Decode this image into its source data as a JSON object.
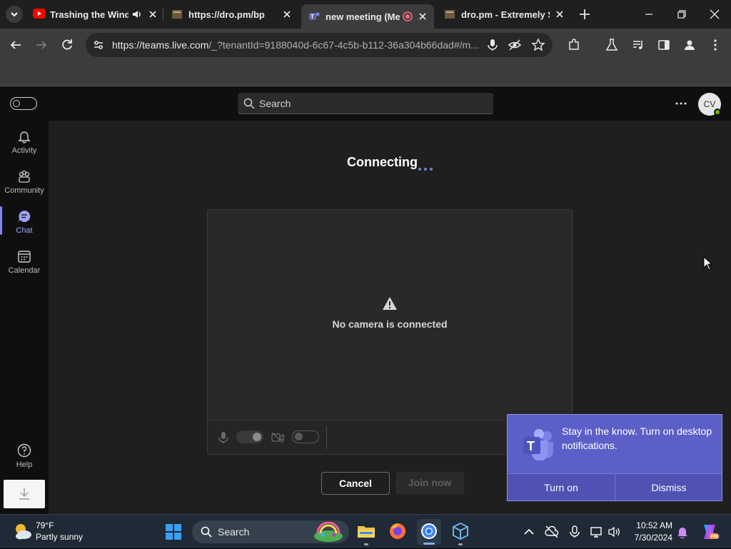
{
  "browser": {
    "tabs": [
      {
        "title": "Trashing the Windo",
        "favicon": "youtube-icon",
        "audio": "speaker-icon"
      },
      {
        "title": "https://dro.pm/bp",
        "favicon": "page-icon"
      },
      {
        "title": "new meeting (Mee",
        "favicon": "teams-icon",
        "recording": "record-icon"
      },
      {
        "title": "dro.pm - Extremely Sh",
        "favicon": "page-icon"
      }
    ],
    "address_bar": {
      "url_host": "https://teams.live.com",
      "url_rest": "/_?tenantId=9188040d-6c67-4c5b-b112-36a304b66dad#/m..."
    }
  },
  "teams": {
    "search_placeholder": "Search",
    "avatar_initials": "CV",
    "rail": [
      {
        "label": "Activity",
        "icon": "bell-icon"
      },
      {
        "label": "Community",
        "icon": "community-icon"
      },
      {
        "label": "Chat",
        "icon": "chat-icon",
        "active": true
      },
      {
        "label": "Calendar",
        "icon": "calendar-icon"
      }
    ],
    "help_label": "Help",
    "prejoin": {
      "status": "Connecting",
      "camera_message": "No camera is connected",
      "cancel_label": "Cancel",
      "join_label": "Join now"
    },
    "toast": {
      "message": "Stay in the know. Turn on desktop notifications.",
      "turn_on_label": "Turn on",
      "dismiss_label": "Dismiss"
    }
  },
  "taskbar": {
    "weather_temp": "79°F",
    "weather_condition": "Partly sunny",
    "search_label": "Search",
    "time": "10:52 AM",
    "date": "7/30/2024"
  },
  "colors": {
    "teams_accent": "#5b5fc7",
    "stage_bg": "#1f1f1f",
    "rail_active": "#9ea2ff"
  }
}
